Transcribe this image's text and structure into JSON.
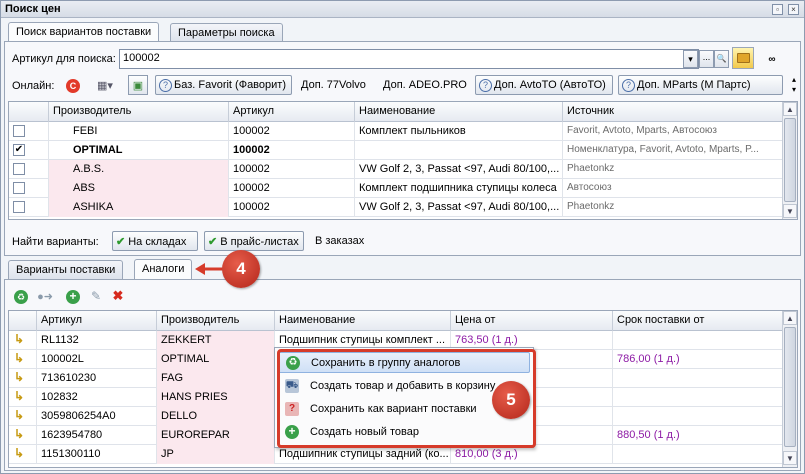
{
  "window": {
    "title": "Поиск цен",
    "buttons": [
      "▫",
      "×"
    ]
  },
  "tabs_top": [
    "Поиск вариантов поставки",
    "Параметры поиска"
  ],
  "search": {
    "label": "Артикул для поиска:",
    "value": "100002",
    "dropdown": "▾",
    "dots": "...",
    "magnifier": "🔍"
  },
  "online": {
    "label": "Онлайн:",
    "buttons": [
      "Баз. Favorit (Фаворит)",
      "Доп. 77Volvo",
      "Доп. ADEO.PRO",
      "Доп. AvtoTO (АвтоТО)",
      "Доп. MParts (М Партс)"
    ]
  },
  "results": {
    "columns": [
      "Производитель",
      "Артикул",
      "Наименование",
      "Источник"
    ],
    "rows": [
      {
        "checked": false,
        "bold": false,
        "pink": false,
        "maker": "FEBI",
        "article": "100002",
        "name": "Комплект пыльников",
        "source": "Favorit, Avtoto, Mparts, Автосоюз"
      },
      {
        "checked": true,
        "bold": true,
        "pink": false,
        "maker": "OPTIMAL",
        "article": "100002",
        "name": "",
        "source": "Номенклатура, Favorit, Avtoto, Mparts, P..."
      },
      {
        "checked": false,
        "bold": false,
        "pink": true,
        "maker": "A.B.S.",
        "article": "100002",
        "name": "VW Golf 2, 3, Passat <97, Audi 80/100,...",
        "source": "Phaetonkz"
      },
      {
        "checked": false,
        "bold": false,
        "pink": true,
        "maker": "ABS",
        "article": "100002",
        "name": "Комплект подшипника ступицы колеса",
        "source": "Автосоюз"
      },
      {
        "checked": false,
        "bold": false,
        "pink": true,
        "maker": "ASHIKA",
        "article": "100002",
        "name": "VW Golf 2, 3, Passat <97, Audi 80/100,...",
        "source": "Phaetonkz"
      }
    ],
    "check_mark": "✔"
  },
  "find": {
    "label": "Найти варианты:",
    "buttons": [
      "На складах",
      "В прайс-листах"
    ],
    "plain": "В заказах"
  },
  "tabs_bottom": [
    "Варианты поставки",
    "Аналоги"
  ],
  "analogs": {
    "columns": [
      "Артикул",
      "Производитель",
      "Наименование",
      "Цена от",
      "Срок поставки от"
    ],
    "rows": [
      {
        "article": "RL1132",
        "maker": "ZEKKERT",
        "name": "Подшипник ступицы комплект ...",
        "price": "763,50 (1 д.)",
        "term": ""
      },
      {
        "article": "100002L",
        "maker": "OPTIMAL",
        "name": "",
        "price": "",
        "term": "786,00 (1 д.)"
      },
      {
        "article": "713610230",
        "maker": "FAG",
        "name": "",
        "price": "",
        "term": ""
      },
      {
        "article": "102832",
        "maker": "HANS PRIES",
        "name": "",
        "price": "",
        "term": ""
      },
      {
        "article": "3059806254A0",
        "maker": "DELLO",
        "name": "",
        "price": "",
        "term": ""
      },
      {
        "article": "1623954780",
        "maker": "EUROREPAR",
        "name": "",
        "price": "",
        "term": "880,50 (1 д.)"
      },
      {
        "article": "1151300110",
        "maker": "JP",
        "name": "Подшипник ступицы задний (ко...",
        "price": "810,00 (3 д.)",
        "term": ""
      }
    ]
  },
  "context_menu": {
    "items": [
      "Сохранить в группу аналогов",
      "Создать товар и добавить в корзину",
      "Сохранить как вариант поставки",
      "Создать новый товар"
    ]
  },
  "callouts": {
    "tab": "4",
    "menu": "5"
  },
  "colors": {
    "accent_red": "#d63b2a",
    "purple_price": "#8d1aa5",
    "pink_row": "#fbe8ee"
  }
}
